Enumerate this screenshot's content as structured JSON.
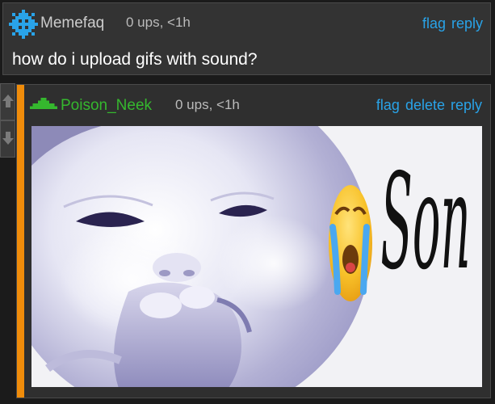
{
  "parent_comment": {
    "username": "Memefaq",
    "meta": "0 ups, <1h",
    "actions": {
      "flag": "flag",
      "reply": "reply"
    },
    "text": "how do i upload gifs with sound?",
    "avatar_icon": "pixel-snowflake-icon",
    "avatar_color": "#29a3e8"
  },
  "reply_comment": {
    "username": "Poison_Neek",
    "meta": "0 ups, <1h",
    "actions": {
      "flag": "flag",
      "delete": "delete",
      "reply": "reply"
    },
    "avatar_icon": "pixel-triangle-icon",
    "avatar_color": "#35b82e",
    "image": {
      "emoji": "crying-emoji",
      "caption": "Son"
    }
  },
  "vote": {
    "up_icon": "arrow-up-icon",
    "down_icon": "arrow-down-icon"
  },
  "colors": {
    "link": "#29a3e8",
    "reply_accent": "#f08c0a",
    "username_reply": "#35b82e"
  }
}
